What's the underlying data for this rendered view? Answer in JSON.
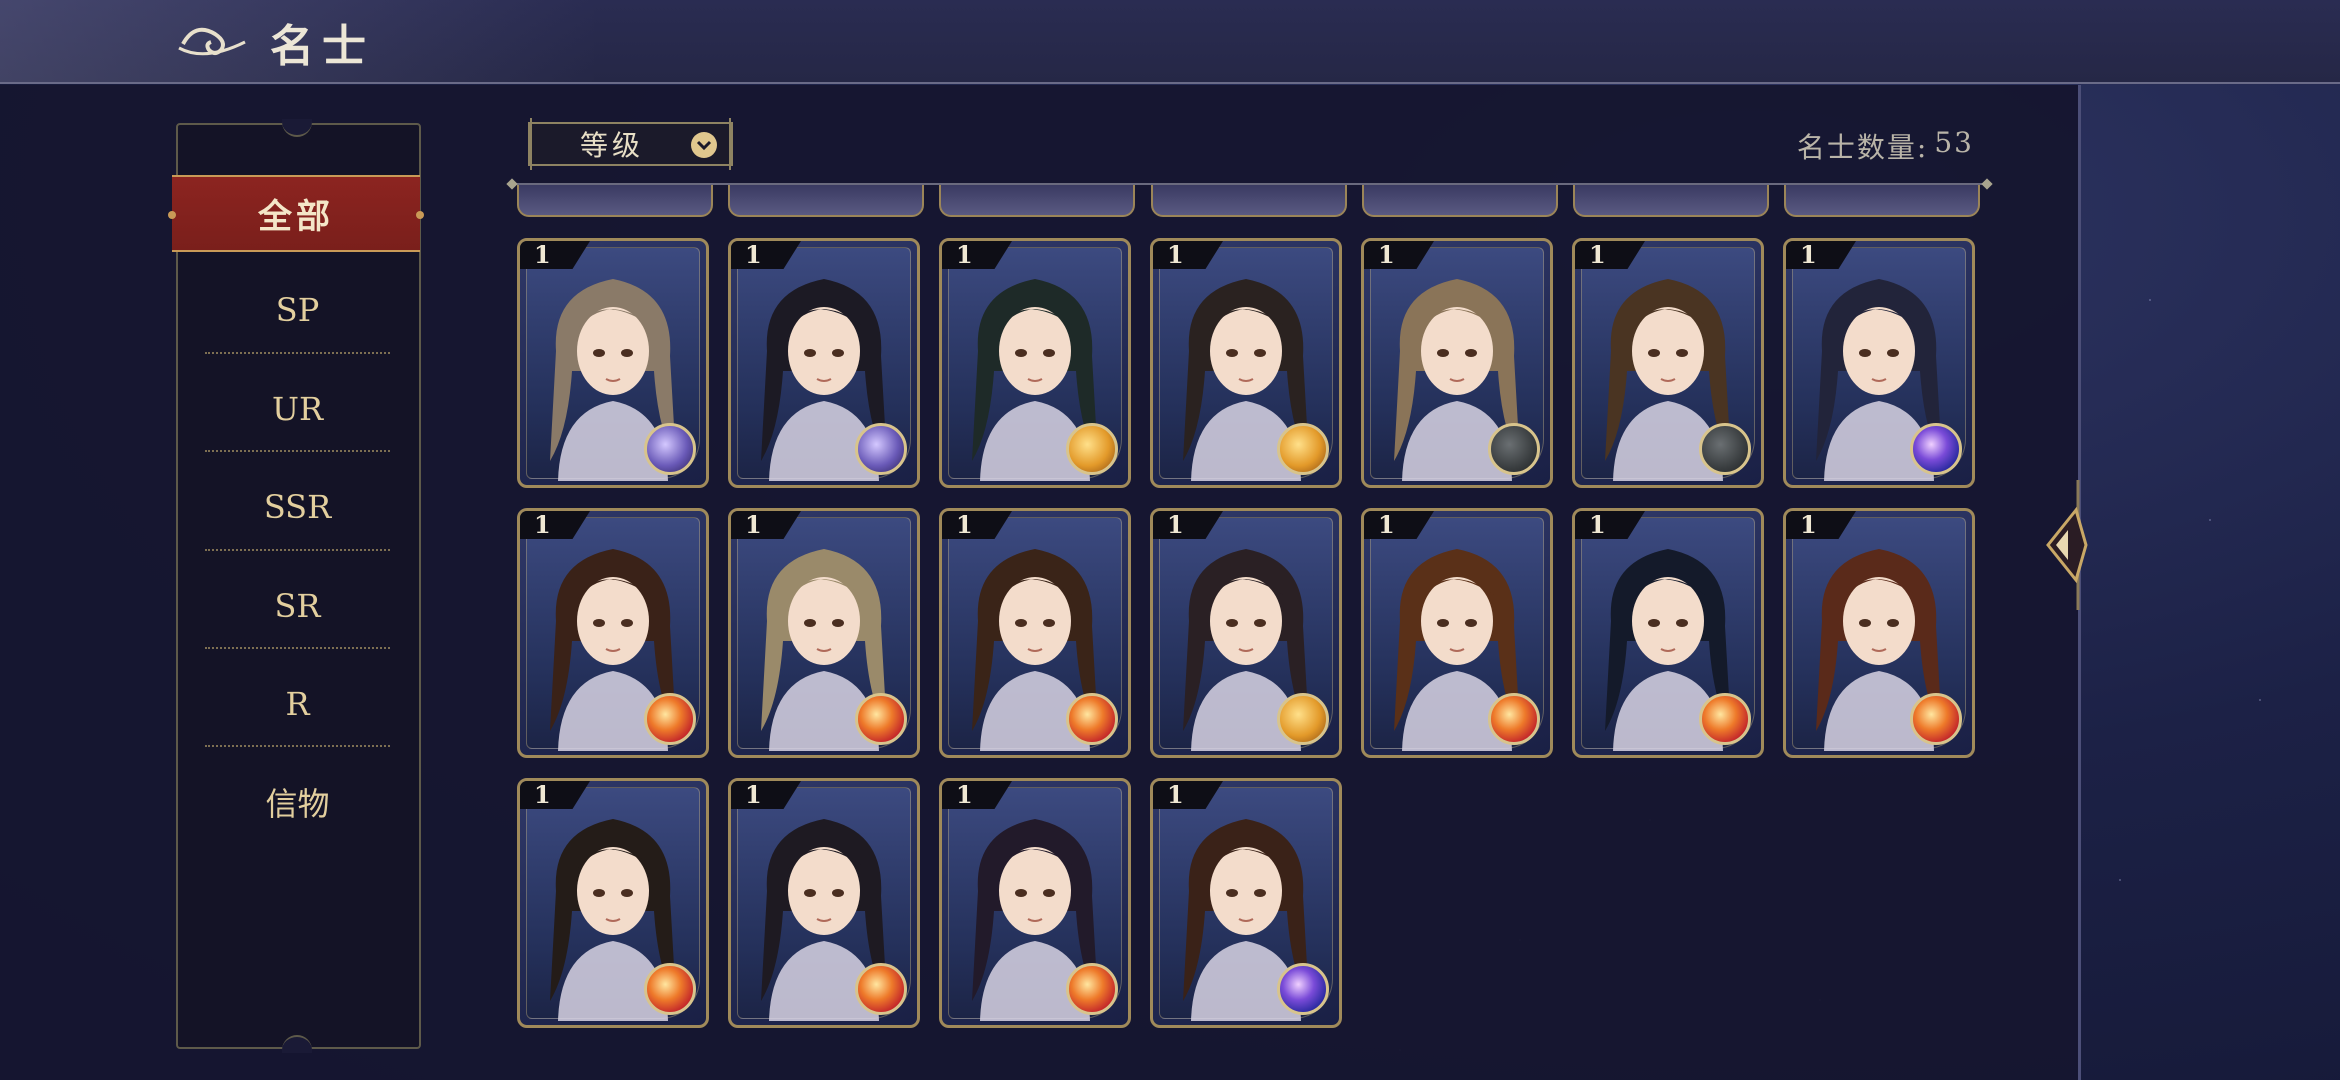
{
  "header": {
    "title": "名士",
    "colors": {
      "accent": "#8c2420",
      "gold": "#c99a57"
    }
  },
  "sidebar": {
    "tabs": [
      {
        "label": "全部",
        "active": true
      },
      {
        "label": "SP"
      },
      {
        "label": "UR"
      },
      {
        "label": "SSR"
      },
      {
        "label": "SR"
      },
      {
        "label": "R"
      },
      {
        "label": "信物"
      }
    ]
  },
  "sort": {
    "label": "等级",
    "icon": "chevron-down-icon"
  },
  "count": {
    "label": "名士数量:",
    "value": "53"
  },
  "cards": [
    {
      "level": "1",
      "hair": "#8a7a68",
      "emblem": "purple"
    },
    {
      "level": "1",
      "hair": "#1c1a24",
      "emblem": "purple"
    },
    {
      "level": "1",
      "hair": "#1e2a28",
      "emblem": "gold"
    },
    {
      "level": "1",
      "hair": "#2a2220",
      "emblem": "gold"
    },
    {
      "level": "1",
      "hair": "#8a7458",
      "emblem": "dark"
    },
    {
      "level": "1",
      "hair": "#4a3422",
      "emblem": "dark"
    },
    {
      "level": "1",
      "hair": "#22243a",
      "emblem": "orb"
    },
    {
      "level": "1",
      "hair": "#3a2218",
      "emblem": "red"
    },
    {
      "level": "1",
      "hair": "#9a8a6a",
      "emblem": "red"
    },
    {
      "level": "1",
      "hair": "#3a2418",
      "emblem": "red"
    },
    {
      "level": "1",
      "hair": "#2a2024",
      "emblem": "gold"
    },
    {
      "level": "1",
      "hair": "#5a3018",
      "emblem": "red"
    },
    {
      "level": "1",
      "hair": "#141a2a",
      "emblem": "red"
    },
    {
      "level": "1",
      "hair": "#5a2a1a",
      "emblem": "red"
    },
    {
      "level": "1",
      "hair": "#241c18",
      "emblem": "red"
    },
    {
      "level": "1",
      "hair": "#1e1a22",
      "emblem": "red"
    },
    {
      "level": "1",
      "hair": "#221a2a",
      "emblem": "red"
    },
    {
      "level": "1",
      "hair": "#3a2218",
      "emblem": "orb"
    }
  ]
}
